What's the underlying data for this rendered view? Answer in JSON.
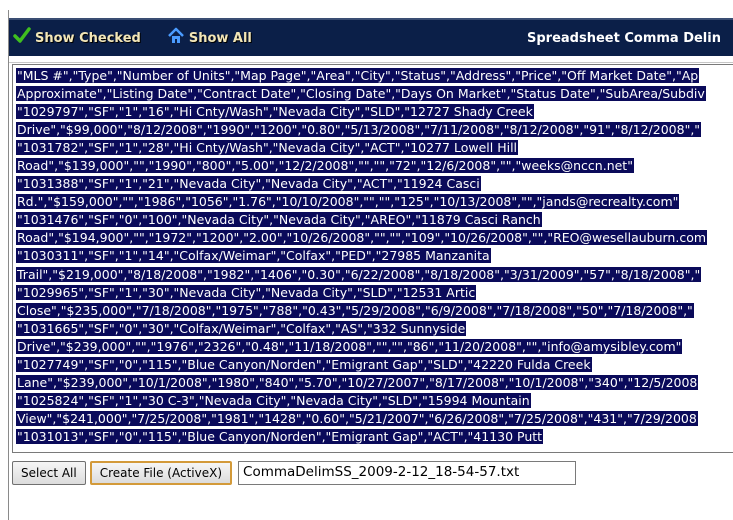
{
  "toolbar": {
    "show_checked_label": "Show Checked",
    "show_all_label": "Show All",
    "title": "Spreadsheet Comma Delin",
    "check_icon_color": "#3fbf1f",
    "home_icon_color": "#4a9bff"
  },
  "export": {
    "lines": [
      "\"MLS #\",\"Type\",\"Number of Units\",\"Map Page\",\"Area\",\"City\",\"Status\",\"Address\",\"Price\",\"Off Market Date\",\"Ap",
      "Approximate\",\"Listing Date\",\"Contract Date\",\"Closing Date\",\"Days On Market\",\"Status Date\",\"SubArea/Subdiv",
      "\"1029797\",\"SF\",\"1\",\"16\",\"Hi Cnty/Wash\",\"Nevada City\",\"SLD\",\"12727  Shady Creek",
      "Drive\",\"$99,000\",\"8/12/2008\",\"1990\",\"1200\",\"0.80\",\"5/13/2008\",\"7/11/2008\",\"8/12/2008\",\"91\",\"8/12/2008\",\"",
      "\"1031782\",\"SF\",\"1\",\"28\",\"Hi Cnty/Wash\",\"Nevada City\",\"ACT\",\"10277  Lowell Hill",
      "Road\",\"$139,000\",\"\",\"1990\",\"800\",\"5.00\",\"12/2/2008\",\"\",\"\",\"72\",\"12/6/2008\",\"\",\"weeks@nccn.net\"",
      "\"1031388\",\"SF\",\"1\",\"21\",\"Nevada City\",\"Nevada City\",\"ACT\",\"11924  Casci",
      "Rd.\",\"$159,000\",\"\",\"1986\",\"1056\",\"1.76\",\"10/10/2008\",\"\",\"\",\"125\",\"10/13/2008\",\"\",\"jands@recrealty.com\"",
      "\"1031476\",\"SF\",\"0\",\"100\",\"Nevada City\",\"Nevada City\",\"AREO\",\"11879  Casci Ranch",
      "Road\",\"$194,900\",\"\",\"1972\",\"1200\",\"2.00\",\"10/26/2008\",\"\",\"\",\"109\",\"10/26/2008\",\"\",\"REO@wesellauburn.com",
      "\"1030311\",\"SF\",\"1\",\"14\",\"Colfax/Weimar\",\"Colfax\",\"PED\",\"27985  Manzanita",
      "Trail\",\"$219,000\",\"8/18/2008\",\"1982\",\"1406\",\"0.30\",\"6/22/2008\",\"8/18/2008\",\"3/31/2009\",\"57\",\"8/18/2008\",\"",
      "\"1029965\",\"SF\",\"1\",\"30\",\"Nevada City\",\"Nevada City\",\"SLD\",\"12531  Artic",
      "Close\",\"$235,000\",\"7/18/2008\",\"1975\",\"788\",\"0.43\",\"5/29/2008\",\"6/9/2008\",\"7/18/2008\",\"50\",\"7/18/2008\",\"",
      "\"1031665\",\"SF\",\"0\",\"30\",\"Colfax/Weimar\",\"Colfax\",\"AS\",\"332  Sunnyside",
      "Drive\",\"$239,000\",\"\",\"1976\",\"2326\",\"0.48\",\"11/18/2008\",\"\",\"\",\"86\",\"11/20/2008\",\"\",\"info@amysibley.com\"",
      "\"1027749\",\"SF\",\"0\",\"115\",\"Blue Canyon/Norden\",\"Emigrant Gap\",\"SLD\",\"42220  Fulda Creek",
      "Lane\",\"$239,000\",\"10/1/2008\",\"1980\",\"840\",\"5.70\",\"10/27/2007\",\"8/17/2008\",\"10/1/2008\",\"340\",\"12/5/2008",
      "\"1025824\",\"SF\",\"1\",\"30 C-3\",\"Nevada City\",\"Nevada City\",\"SLD\",\"15994  Mountain",
      "View\",\"$241,000\",\"7/25/2008\",\"1981\",\"1428\",\"0.60\",\"5/21/2007\",\"6/26/2008\",\"7/25/2008\",\"431\",\"7/29/2008",
      "\"1031013\",\"SF\",\"0\",\"115\",\"Blue Canyon/Norden\",\"Emigrant Gap\",\"ACT\",\"41130  Putt"
    ]
  },
  "bottom": {
    "select_all_label": "Select All",
    "create_file_label": "Create File (ActiveX)",
    "filename_value": "CommaDelimSS_2009-2-12_18-54-57.txt"
  }
}
